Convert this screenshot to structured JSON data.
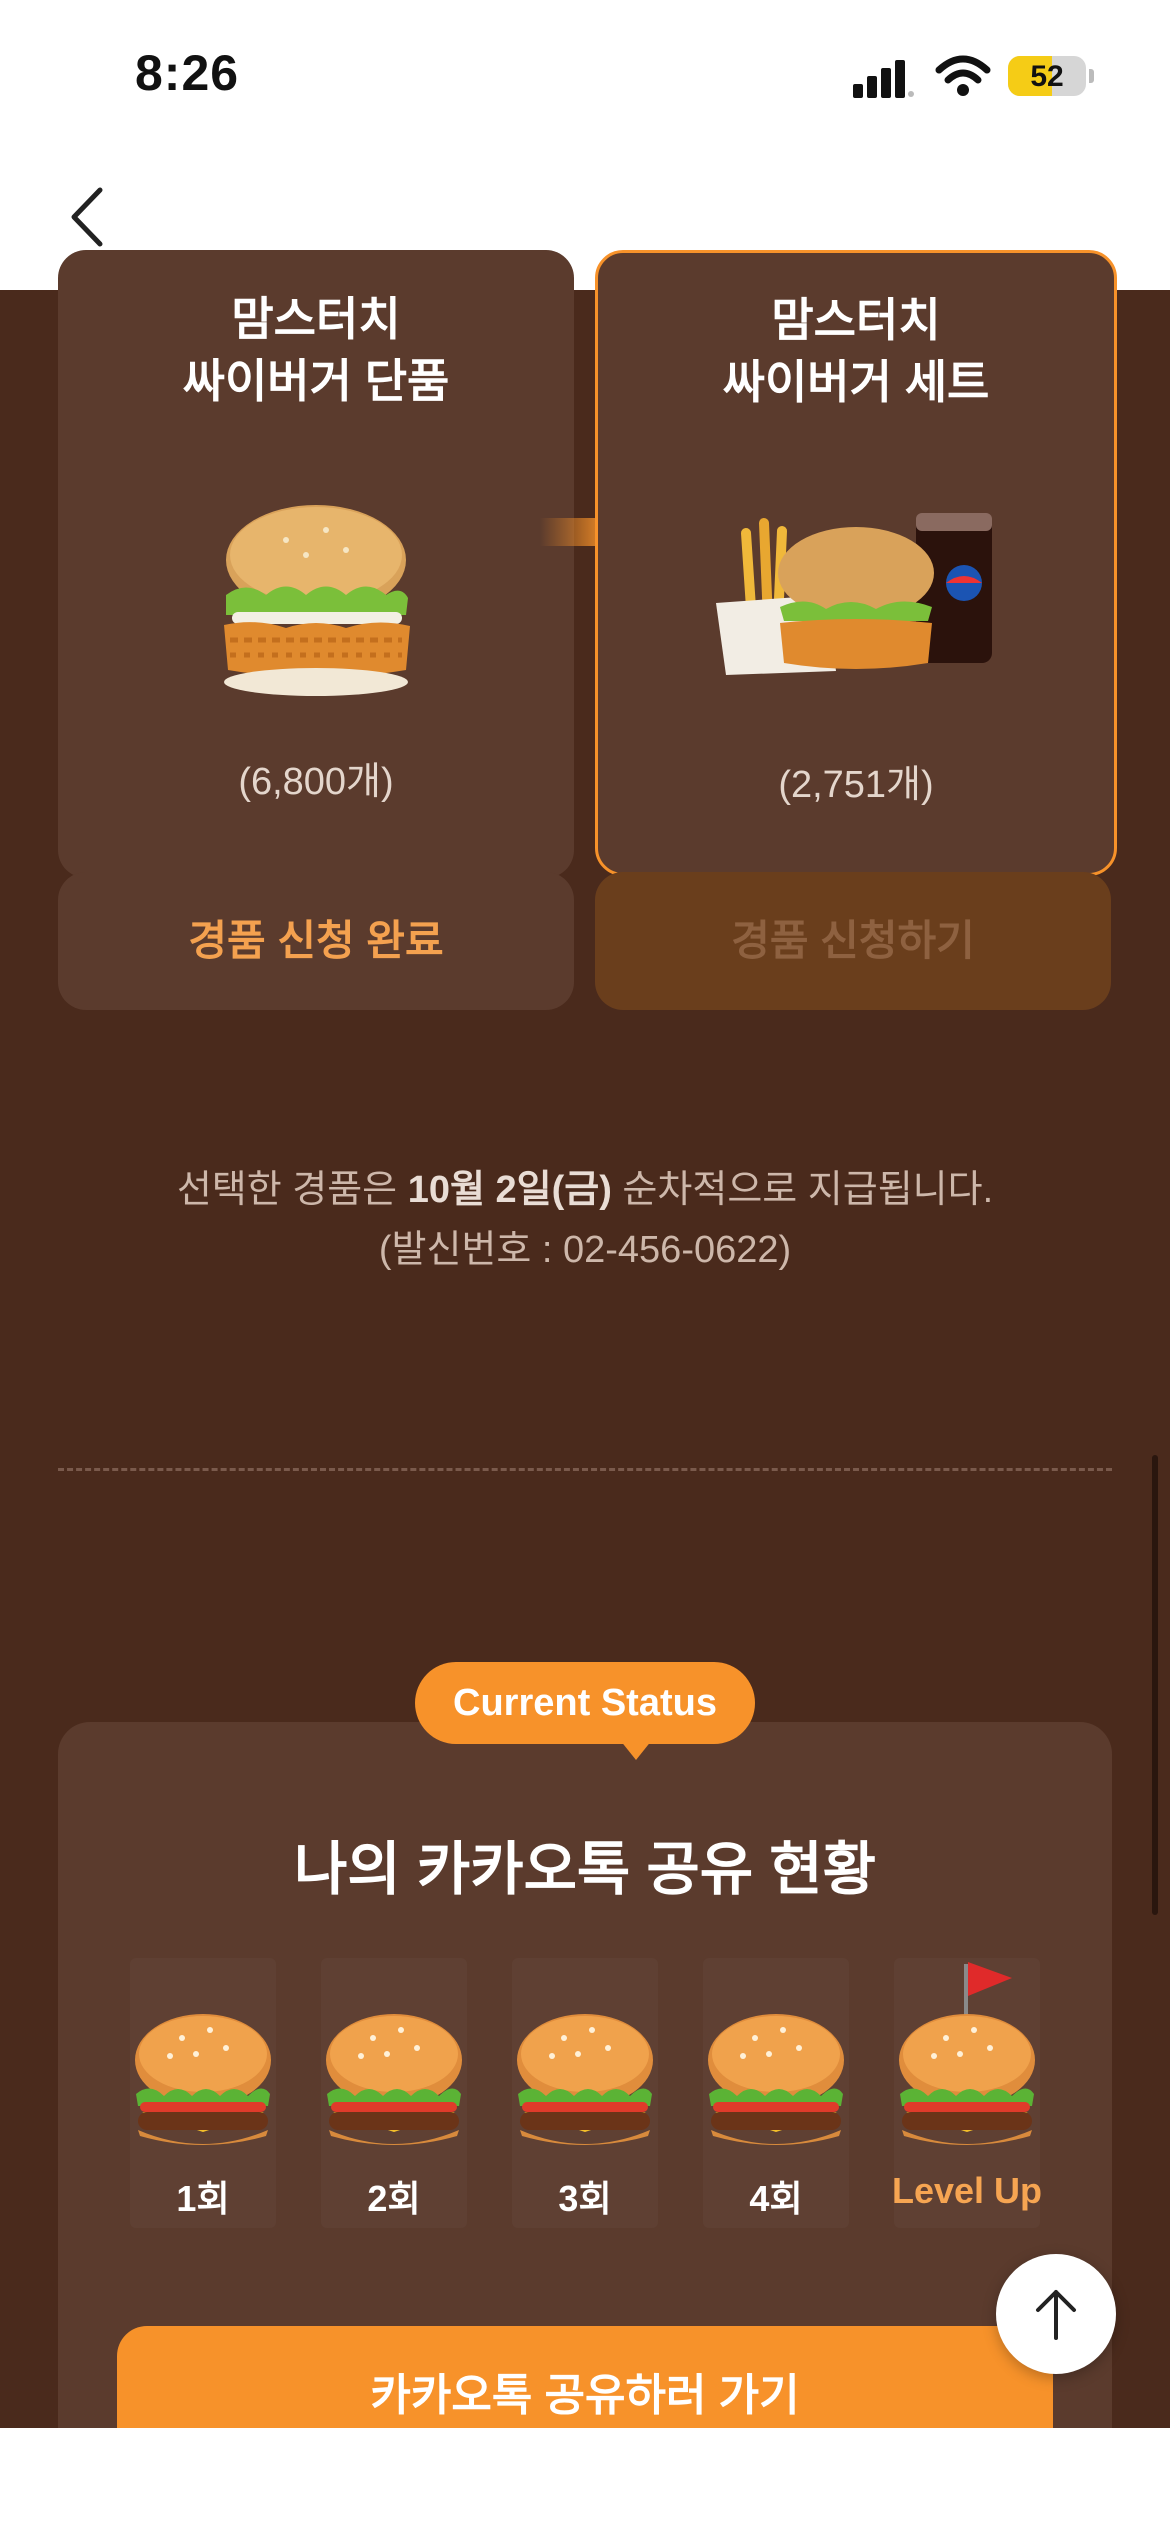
{
  "status_bar": {
    "time": "8:26",
    "battery": "52"
  },
  "prizes": [
    {
      "title_line1": "맘스터치",
      "title_line2": "싸이버거 단품",
      "count": "(6,800개)",
      "button": "경품 신청 완료"
    },
    {
      "title_line1": "맘스터치",
      "title_line2": "싸이버거 세트",
      "count": "(2,751개)",
      "button": "경품 신청하기"
    }
  ],
  "notice": {
    "line1_prefix": "선택한 경품은 ",
    "line1_bold": "10월 2일(금)",
    "line1_suffix": " 순차적으로 지급됩니다.",
    "line2": "(발신번호 : 02-456-0622)"
  },
  "status": {
    "tag": "Current Status",
    "title": "나의 카카오톡 공유 현황",
    "steps": [
      "1회",
      "2회",
      "3회",
      "4회",
      "Level Up"
    ],
    "share_button": "카카오톡 공유하러 가기"
  },
  "colors": {
    "accent": "#f7922a",
    "background": "#4a2a1c",
    "card": "#5b3b2d"
  }
}
